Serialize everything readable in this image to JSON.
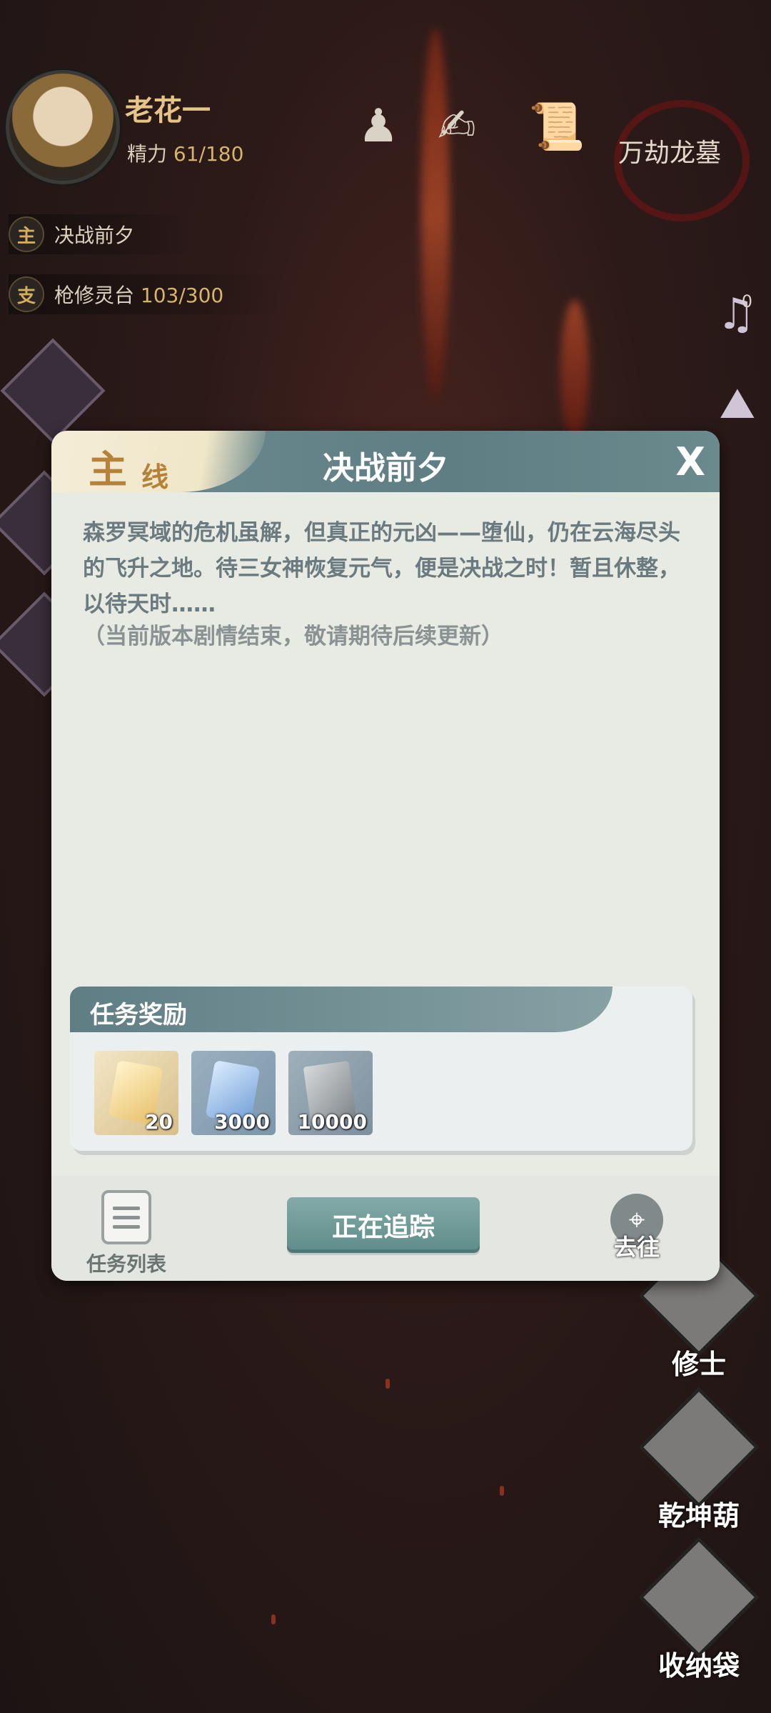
{
  "player": {
    "name": "老花一",
    "energy_label": "精力",
    "energy_value": "61/180"
  },
  "location": "万劫龙墓",
  "top_icons": [
    "chess-pawn-icon",
    "hand-scroll-icon",
    "scroll-icon"
  ],
  "quests": [
    {
      "tag": "主",
      "text": "决战前夕",
      "progress": ""
    },
    {
      "tag": "支",
      "text": "枪修灵台",
      "progress": "103/300"
    }
  ],
  "side_count": "0",
  "right_buttons": [
    "修士",
    "乾坤葫",
    "收纳袋"
  ],
  "dialog": {
    "tag_big": "主",
    "tag_small": "线",
    "title": "决战前夕",
    "close": "X",
    "body": "森罗冥域的危机虽解，但真正的元凶——堕仙，仍在云海尽头的飞升之地。待三女神恢复元气，便是决战之时！暂且休整，以待天时……",
    "note": "（当前版本剧情结束，敬请期待后续更新）",
    "reward_title": "任务奖励",
    "rewards": [
      {
        "icon": "golden-crystal-icon",
        "count": "20",
        "color": "#e8c06a"
      },
      {
        "icon": "blue-crystal-icon",
        "count": "3000",
        "color": "#8fb6e0"
      },
      {
        "icon": "scroll-bundle-icon",
        "count": "10000",
        "color": "#9aa4a8"
      }
    ],
    "footer": {
      "list_label": "任务列表",
      "track_label": "正在追踪",
      "goto_label": "去往"
    }
  }
}
